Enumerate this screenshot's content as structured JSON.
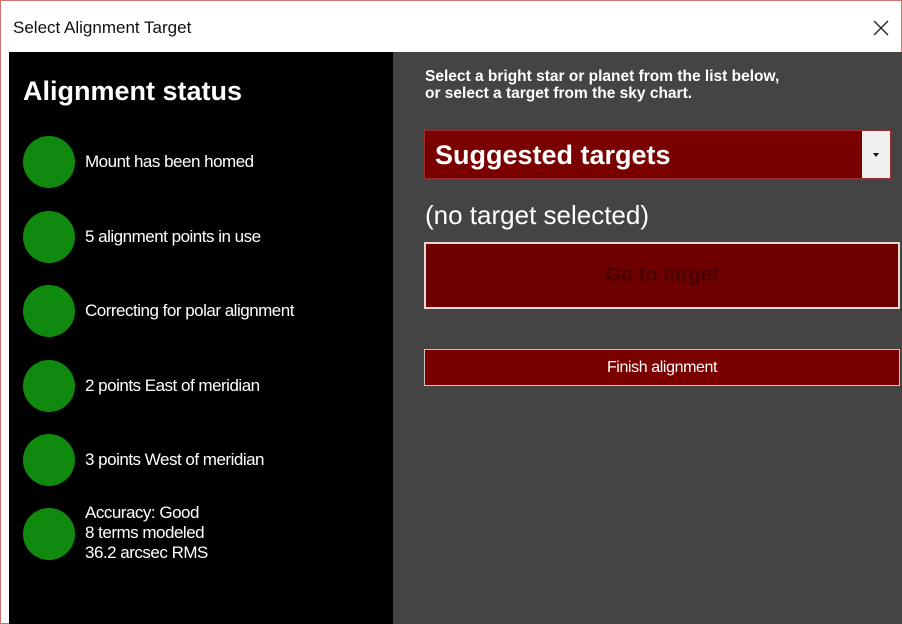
{
  "window": {
    "title": "Select Alignment Target",
    "close_icon": "close-icon"
  },
  "status_panel": {
    "heading": "Alignment status",
    "items": [
      {
        "label": "Mount has been homed",
        "indicator_color": "#0f8a0f"
      },
      {
        "label": "5 alignment points in use",
        "indicator_color": "#0f8a0f"
      },
      {
        "label": "Correcting for polar alignment",
        "indicator_color": "#0f8a0f"
      },
      {
        "label": "2 points East of meridian",
        "indicator_color": "#0f8a0f"
      },
      {
        "label": "3 points West of meridian",
        "indicator_color": "#0f8a0f"
      },
      {
        "label": "Accuracy: Good\n8 terms modeled\n36.2 arcsec RMS",
        "indicator_color": "#0f8a0f"
      }
    ]
  },
  "target_panel": {
    "instructions_line1": "Select a bright star or planet from the list below,",
    "instructions_line2": "or select a target from the sky chart.",
    "target_select": {
      "selected": "Suggested targets",
      "dropdown_icon": "chevron-down-icon"
    },
    "selected_target": "(no target selected)",
    "goto_button": "Go to target",
    "finish_button": "Finish alignment"
  },
  "colors": {
    "left_background": "#000000",
    "right_background": "#444444",
    "accent_red": "#7a0000",
    "status_green": "#0f8a0f"
  }
}
